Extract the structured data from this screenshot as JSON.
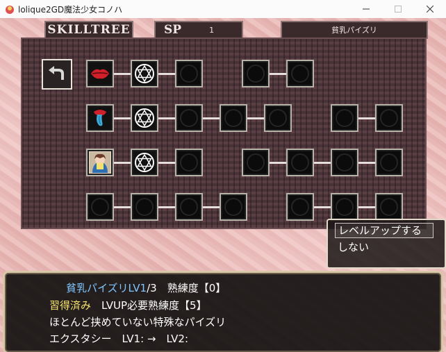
{
  "window": {
    "title": "lolique2GD魔法少女コノハ",
    "min_icon": "minimize-icon",
    "max_icon": "maximize-icon",
    "close_icon": "close-icon"
  },
  "header": {
    "skilltree_label": "SKILLTREE",
    "sp_label": "SP",
    "sp_value": "1",
    "skill_name": "貧乳パイズリ"
  },
  "tree": {
    "back_icon": "back-arrow-icon",
    "rows": [
      {
        "icons": [
          "lips-icon",
          "hexagram-icon",
          "locked-node-icon",
          "locked-node-icon",
          "locked-node-icon"
        ]
      },
      {
        "icons": [
          "tongue-icon",
          "hexagram-icon",
          "locked-node-icon",
          "locked-node-icon",
          "locked-node-icon",
          "locked-node-icon",
          "locked-node-icon"
        ]
      },
      {
        "icons": [
          "portrait-icon",
          "hexagram-icon",
          "locked-node-icon",
          "locked-node-icon",
          "locked-node-icon",
          "locked-node-icon",
          "locked-node-icon"
        ]
      },
      {
        "icons": [
          "locked-node-icon",
          "locked-node-icon",
          "locked-node-icon",
          "locked-node-icon",
          "locked-node-icon",
          "locked-node-icon",
          "locked-node-icon"
        ]
      }
    ]
  },
  "menu": {
    "level_up": "レベルアップする",
    "cancel": "しない"
  },
  "message": {
    "skill_level": "貧乳パイズリLV1",
    "level_max": "/3",
    "proficiency": "熟練度【0】",
    "acquired": "習得済み",
    "lvup_req": "LVUP必要熟練度【5】",
    "description": "ほとんど挟めていない特殊なパイズリ",
    "ecstasy": "エクスタシー　LV1: →　LV2:"
  },
  "colors": {
    "blue_text": "#7fc7ff",
    "yellow_text": "#f6e36c",
    "frame": "#d7c8a7"
  }
}
